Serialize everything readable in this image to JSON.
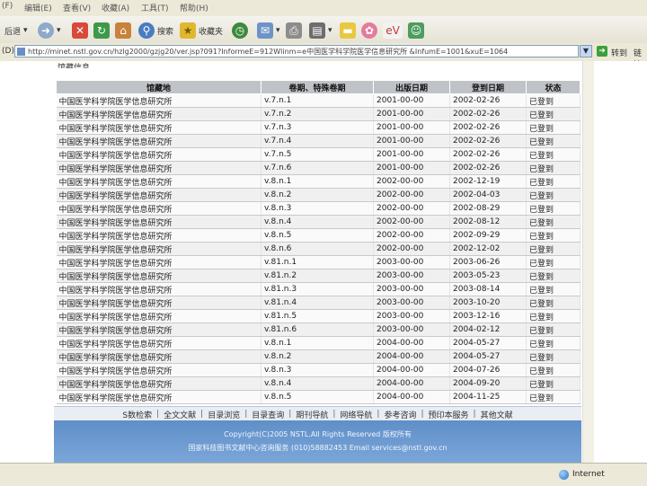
{
  "menubar": {
    "items": [
      "(F)",
      "编辑(E)",
      "查看(V)",
      "收藏(A)",
      "工具(T)",
      "帮助(H)"
    ]
  },
  "toolbar": {
    "back_label": "后退",
    "search_label": "搜索",
    "favorites_label": "收藏夹"
  },
  "address": {
    "label": "(D)",
    "url": "http://minet.nstl.gov.cn/hzlg2000/gzjg20/ver.jsp?091?InformeE=912Wlinm=e中国医学科学院医学信息研究所 &InfumE=1001&xuE=1064",
    "go_label": "转到",
    "links_label": "链接"
  },
  "page": {
    "partial_heading": "馆藏信息"
  },
  "table": {
    "headers": [
      "馆藏地",
      "卷期、特殊卷期",
      "出版日期",
      "登到日期",
      "状态"
    ],
    "rows": [
      [
        "中国医学科学院医学信息研究所",
        "v.7.n.1",
        "2001-00-00",
        "2002-02-26",
        "已登到"
      ],
      [
        "中国医学科学院医学信息研究所",
        "v.7.n.2",
        "2001-00-00",
        "2002-02-26",
        "已登到"
      ],
      [
        "中国医学科学院医学信息研究所",
        "v.7.n.3",
        "2001-00-00",
        "2002-02-26",
        "已登到"
      ],
      [
        "中国医学科学院医学信息研究所",
        "v.7.n.4",
        "2001-00-00",
        "2002-02-26",
        "已登到"
      ],
      [
        "中国医学科学院医学信息研究所",
        "v.7.n.5",
        "2001-00-00",
        "2002-02-26",
        "已登到"
      ],
      [
        "中国医学科学院医学信息研究所",
        "v.7.n.6",
        "2001-00-00",
        "2002-02-26",
        "已登到"
      ],
      [
        "中国医学科学院医学信息研究所",
        "v.8.n.1",
        "2002-00-00",
        "2002-12-19",
        "已登到"
      ],
      [
        "中国医学科学院医学信息研究所",
        "v.8.n.2",
        "2002-00-00",
        "2002-04-03",
        "已登到"
      ],
      [
        "中国医学科学院医学信息研究所",
        "v.8.n.3",
        "2002-00-00",
        "2002-08-29",
        "已登到"
      ],
      [
        "中国医学科学院医学信息研究所",
        "v.8.n.4",
        "2002-00-00",
        "2002-08-12",
        "已登到"
      ],
      [
        "中国医学科学院医学信息研究所",
        "v.8.n.5",
        "2002-00-00",
        "2002-09-29",
        "已登到"
      ],
      [
        "中国医学科学院医学信息研究所",
        "v.8.n.6",
        "2002-00-00",
        "2002-12-02",
        "已登到"
      ],
      [
        "中国医学科学院医学信息研究所",
        "v.81.n.1",
        "2003-00-00",
        "2003-06-26",
        "已登到"
      ],
      [
        "中国医学科学院医学信息研究所",
        "v.81.n.2",
        "2003-00-00",
        "2003-05-23",
        "已登到"
      ],
      [
        "中国医学科学院医学信息研究所",
        "v.81.n.3",
        "2003-00-00",
        "2003-08-14",
        "已登到"
      ],
      [
        "中国医学科学院医学信息研究所",
        "v.81.n.4",
        "2003-00-00",
        "2003-10-20",
        "已登到"
      ],
      [
        "中国医学科学院医学信息研究所",
        "v.81.n.5",
        "2003-00-00",
        "2003-12-16",
        "已登到"
      ],
      [
        "中国医学科学院医学信息研究所",
        "v.81.n.6",
        "2003-00-00",
        "2004-02-12",
        "已登到"
      ],
      [
        "中国医学科学院医学信息研究所",
        "v.8.n.1",
        "2004-00-00",
        "2004-05-27",
        "已登到"
      ],
      [
        "中国医学科学院医学信息研究所",
        "v.8.n.2",
        "2004-00-00",
        "2004-05-27",
        "已登到"
      ],
      [
        "中国医学科学院医学信息研究所",
        "v.8.n.3",
        "2004-00-00",
        "2004-07-26",
        "已登到"
      ],
      [
        "中国医学科学院医学信息研究所",
        "v.8.n.4",
        "2004-00-00",
        "2004-09-20",
        "已登到"
      ],
      [
        "中国医学科学院医学信息研究所",
        "v.8.n.5",
        "2004-00-00",
        "2004-11-25",
        "已登到"
      ]
    ]
  },
  "footer_nav": {
    "items": [
      "S数检索",
      "全文文献",
      "目录浏览",
      "目录查询",
      "期刊导航",
      "网络导航",
      "参考咨询",
      "预印本服务",
      "其他文献"
    ]
  },
  "footer": {
    "copyright": "Copyright(C)2005 NSTL.All Rights Reserved 版权所有",
    "contact": "国家科技图书文献中心咨询服务 (010)58882453 Email services@nstl.gov.cn"
  },
  "statusbar": {
    "zone": "Internet"
  }
}
